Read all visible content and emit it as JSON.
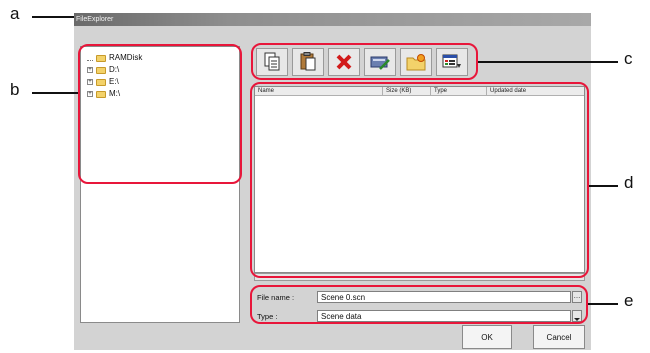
{
  "window": {
    "title": "FileExplorer"
  },
  "tree": {
    "items": [
      {
        "label": "RAMDisk",
        "expander": ""
      },
      {
        "label": "D:\\",
        "expander": "+"
      },
      {
        "label": "E:\\",
        "expander": "+"
      },
      {
        "label": "M:\\",
        "expander": "+"
      }
    ]
  },
  "toolbar": {
    "buttons": [
      {
        "icon": "copy-icon"
      },
      {
        "icon": "paste-icon"
      },
      {
        "icon": "delete-icon"
      },
      {
        "icon": "rename-icon"
      },
      {
        "icon": "new-folder-icon"
      },
      {
        "icon": "view-icon"
      }
    ]
  },
  "file_list": {
    "columns": [
      "Name",
      "Size (KB)",
      "Type",
      "Updated date"
    ]
  },
  "form": {
    "file_name_label": "File name :",
    "file_name_value": "Scene 0.scn",
    "type_label": "Type :",
    "type_value": "Scene data"
  },
  "buttons": {
    "ok": "OK",
    "cancel": "Cancel"
  },
  "callouts": {
    "a": "a",
    "b": "b",
    "c": "c",
    "d": "d",
    "e": "e"
  },
  "colors": {
    "callout": "#e8163a",
    "dialog": "#d3d3d3"
  }
}
